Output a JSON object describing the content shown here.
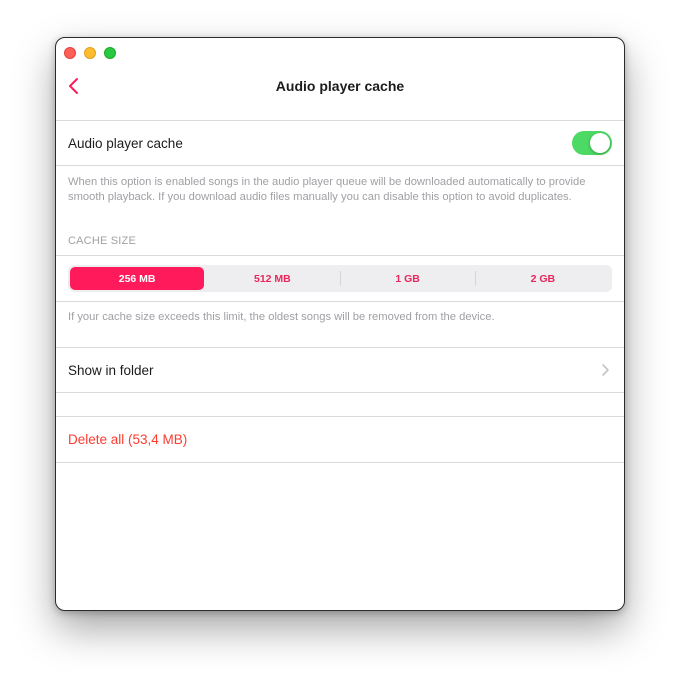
{
  "window": {
    "traffic_lights": [
      "close",
      "minimize",
      "zoom"
    ]
  },
  "navbar": {
    "back_icon": "chevron-left-icon",
    "title": "Audio player cache"
  },
  "cache_toggle": {
    "label": "Audio player cache",
    "enabled": true
  },
  "cache_description": "When this option is enabled songs in the audio player queue will be downloaded automatically to provide smooth playback. If you download audio files manually you can disable this option to avoid duplicates.",
  "cache_size": {
    "header": "CACHE SIZE",
    "options": [
      "256 MB",
      "512 MB",
      "1 GB",
      "2 GB"
    ],
    "selected": "256 MB",
    "footnote": "If your cache size exceeds this limit, the oldest songs will be removed from the device."
  },
  "show_in_folder": {
    "label": "Show in folder",
    "chevron_icon": "chevron-right-icon"
  },
  "delete_all": {
    "label": "Delete all (53,4 MB)"
  },
  "colors": {
    "accent": "#ff1a5b",
    "toggle_on": "#4cd964",
    "destructive": "#ff3b30"
  }
}
